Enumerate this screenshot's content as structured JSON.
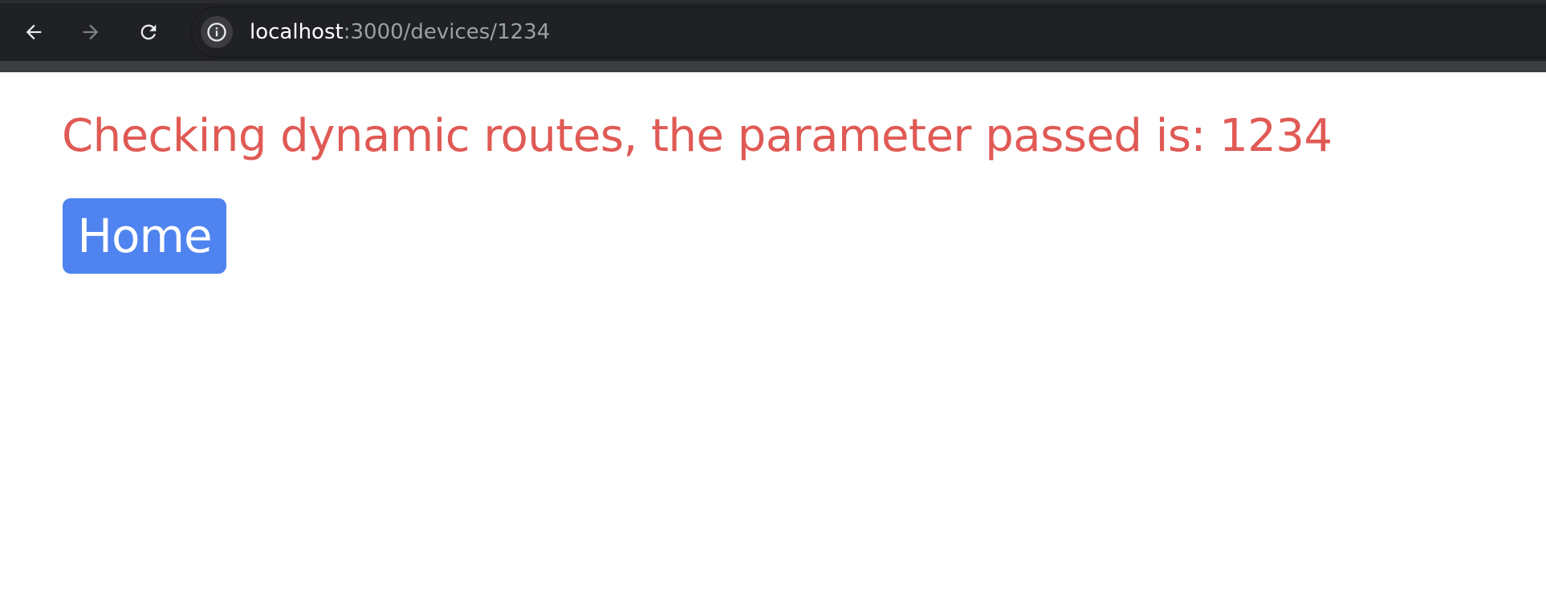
{
  "browser": {
    "url_host": "localhost",
    "url_path": ":3000/devices/1234",
    "back_icon": "arrow-left-icon",
    "forward_icon": "arrow-right-icon",
    "reload_icon": "reload-icon",
    "site_info_icon": "info-icon"
  },
  "page": {
    "heading": "Checking dynamic routes, the parameter passed is: 1234",
    "home_button_label": "Home"
  },
  "colors": {
    "heading": "#e05a55",
    "button": "#4f83ef",
    "toolbar": "#202124"
  }
}
